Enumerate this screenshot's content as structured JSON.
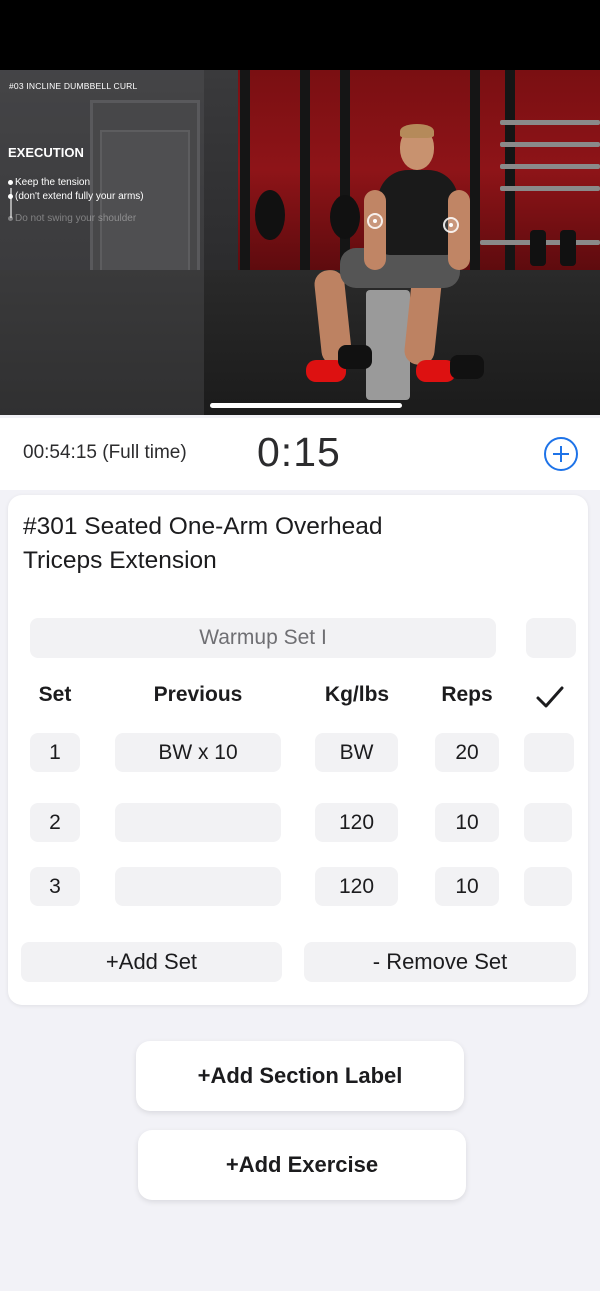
{
  "video": {
    "title": "#03 INCLINE DUMBBELL CURL",
    "heading": "EXECUTION",
    "bullets": [
      "Keep the tension",
      "(don't extend fully your arms)",
      "Do not swing your shoulder"
    ]
  },
  "timer": {
    "full_time": "00:54:15 (Full time)",
    "countdown": "0:15"
  },
  "exercise": {
    "title": "#301 Seated One-Arm Overhead Triceps Extension",
    "warmup_label": "Warmup Set I",
    "columns": {
      "set": "Set",
      "previous": "Previous",
      "weight": "Kg/lbs",
      "reps": "Reps"
    },
    "sets": [
      {
        "set": "1",
        "previous": "BW x 10",
        "weight": "BW",
        "reps": "20"
      },
      {
        "set": "2",
        "previous": "",
        "weight": "120",
        "reps": "10"
      },
      {
        "set": "3",
        "previous": "",
        "weight": "120",
        "reps": "10"
      }
    ],
    "add_set_label": "+Add Set",
    "remove_set_label": "- Remove Set"
  },
  "actions": {
    "add_section_label": "+Add Section Label",
    "add_exercise": "+Add Exercise"
  },
  "colors": {
    "accent": "#1e73e8",
    "field_bg": "#f2f2f4"
  }
}
